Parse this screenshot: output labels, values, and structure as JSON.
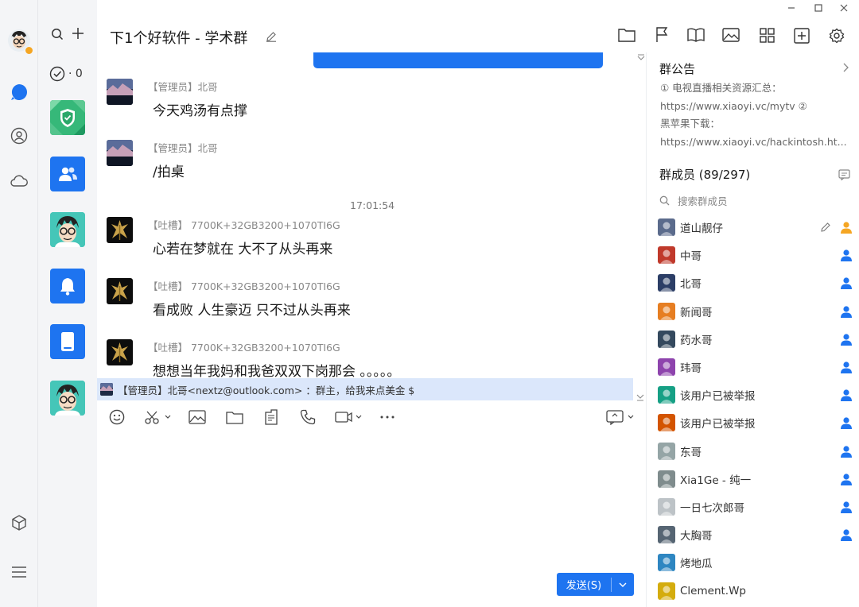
{
  "chat": {
    "title": "下1个好软件 - 学术群",
    "timestamp": "17:01:54",
    "messages": [
      {
        "sender": "【管理员】北哥",
        "text": "今天鸡汤有点撑"
      },
      {
        "sender": "【管理员】北哥",
        "text": "/拍桌"
      },
      {
        "sender": "【吐槽】 7700K+32GB3200+1070TI6G",
        "text": "心若在梦就在 大不了从头再来"
      },
      {
        "sender": "【吐槽】 7700K+32GB3200+1070TI6G",
        "text": "看成败 人生豪迈 只不过从头再来"
      },
      {
        "sender": "【吐槽】 7700K+32GB3200+1070TI6G",
        "text": "想想当年我妈和我爸双双下岗那会 。。。。。"
      }
    ],
    "reply_preview": "【管理员】北哥<nextz@outlook.com> ：群主，给我来点美金 $",
    "send_label": "发送(S)"
  },
  "sessions": {
    "unread_label": "· 0"
  },
  "panel": {
    "notice_title": "群公告",
    "notice_lines": [
      "① 电视直播相关资源汇总：",
      "https://www.xiaoyi.vc/mytv ②",
      " 黑苹果下载：",
      "https://www.xiaoyi.vc/hackintosh.ht..."
    ],
    "members_title": "群成员 (89/297)",
    "search_placeholder": "搜索群成员",
    "members": [
      {
        "name": "道山靓仔",
        "role": "owner"
      },
      {
        "name": "中哥",
        "role": "admin"
      },
      {
        "name": "北哥",
        "role": "admin"
      },
      {
        "name": "新闻哥",
        "role": "admin"
      },
      {
        "name": "药水哥",
        "role": "admin"
      },
      {
        "name": "玮哥",
        "role": "admin"
      },
      {
        "name": "该用户已被举报",
        "role": "admin"
      },
      {
        "name": "该用户已被举报",
        "role": "admin"
      },
      {
        "name": "东哥",
        "role": "admin"
      },
      {
        "name": "Xia1Ge - 纯一",
        "role": "admin"
      },
      {
        "name": "一日七次郎哥",
        "role": "admin"
      },
      {
        "name": "大胸哥",
        "role": "admin"
      },
      {
        "name": "烤地瓜",
        "role": "member"
      },
      {
        "name": "Clement.Wp",
        "role": "member"
      }
    ]
  },
  "colors": {
    "accent": "#1e74f0",
    "owner": "#f5a623"
  }
}
